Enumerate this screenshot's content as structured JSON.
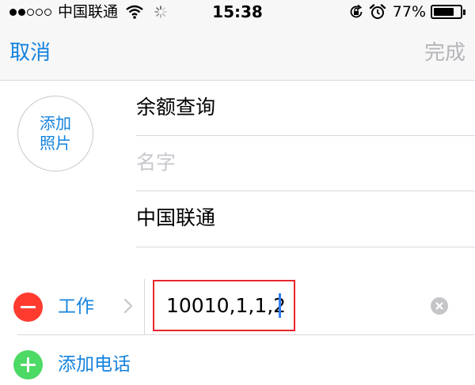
{
  "status_bar": {
    "signal_filled": 2,
    "signal_total": 5,
    "carrier": "中国联通",
    "time": "15:38",
    "battery_percent_label": "77%",
    "battery_level": 0.77
  },
  "nav": {
    "cancel_label": "取消",
    "done_label": "完成"
  },
  "photo": {
    "add_photo_label": "添加照片"
  },
  "name_fields": {
    "field1_value": "余额查询",
    "field2_placeholder": "名字",
    "field3_value": "中国联通"
  },
  "phone": {
    "type_label": "工作",
    "number_value": "10010,1,1,2"
  },
  "add_phone": {
    "label": "添加电话"
  },
  "colors": {
    "accent": "#1583dd",
    "delete_red": "#ff3b30",
    "add_green": "#4cd964",
    "highlight_box": "#e8262c",
    "disabled_gray": "#b5b5ba"
  },
  "icons": {
    "signal": "signal-dots-icon",
    "wifi": "wifi-icon",
    "activity": "activity-spinner-icon",
    "rotation_lock": "rotation-lock-icon",
    "alarm": "alarm-clock-icon",
    "battery": "battery-icon",
    "delete": "minus-circle-icon",
    "chevron": "chevron-right-icon",
    "clear": "clear-x-icon",
    "add": "plus-circle-icon"
  }
}
